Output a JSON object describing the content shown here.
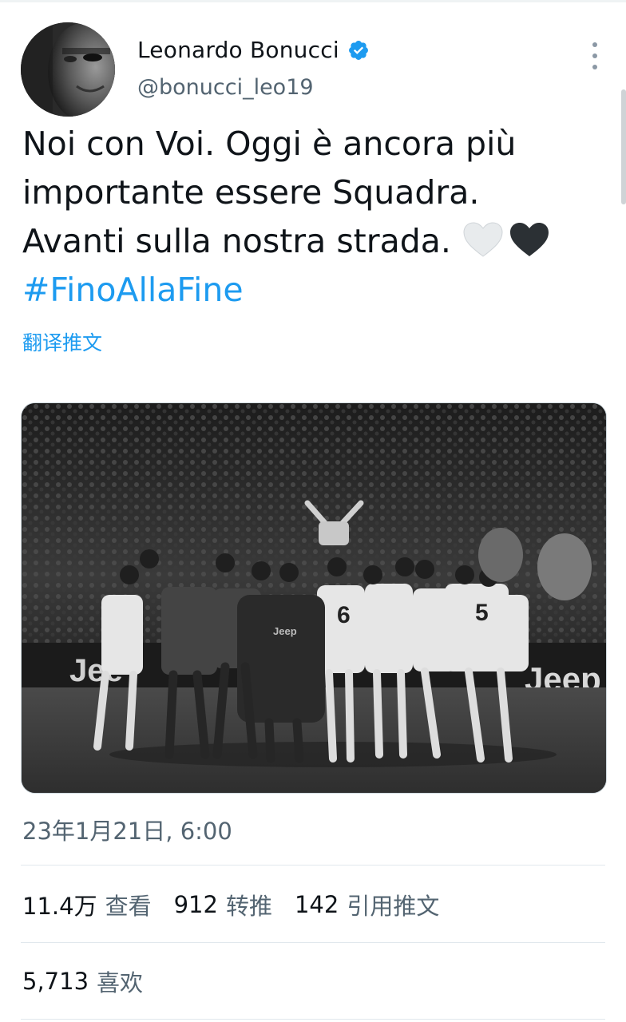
{
  "author": {
    "name": "Leonardo Bonucci",
    "handle": "@bonucci_leo19",
    "verified": true,
    "verified_color": "#1d9bf0"
  },
  "tweet": {
    "lines": [
      "Noi con Voi. Oggi è ancora più",
      "importante essere Squadra.",
      "Avanti sulla nostra strada."
    ],
    "emoji": [
      "white-heart-icon",
      "black-heart-icon"
    ],
    "hashtag": "#FinoAllaFine",
    "translate_label": "翻译推文"
  },
  "image": {
    "alt_icon": "team-huddle-photo"
  },
  "timestamp": "23年1月21日, 6:00",
  "stats": {
    "views_count": "11.4万",
    "views_label": "查看",
    "retweets_count": "912",
    "retweets_label": "转推",
    "quotes_count": "142",
    "quotes_label": "引用推文",
    "likes_count": "5,713",
    "likes_label": "喜欢"
  },
  "colors": {
    "link": "#1d9bf0",
    "text": "#0f1419",
    "secondary": "#536471"
  }
}
